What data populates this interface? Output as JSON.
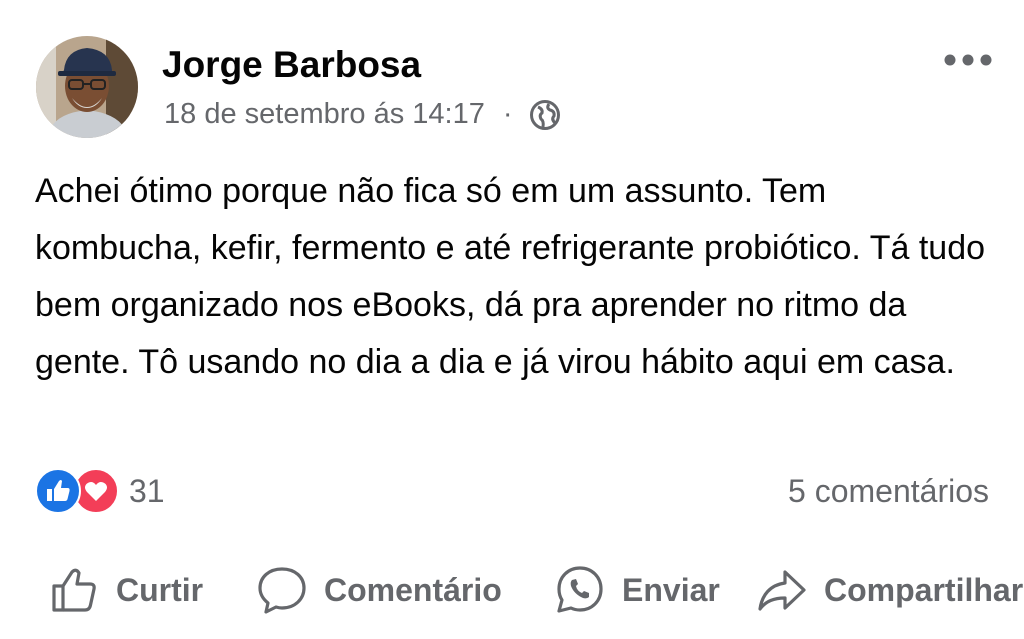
{
  "post": {
    "author": "Jorge Barbosa",
    "timestamp": "18 de setembro ás 14:17",
    "separator": "·",
    "privacy_icon": "globe-icon",
    "text": "Achei ótimo porque não fica só em um assunto. Tem kombucha, kefir, fermento e até refrigerante probiótico. Tá tudo bem organizado nos eBooks, dá pra aprender no ritmo da gente. Tô usando no dia a dia e já virou hábito aqui em casa."
  },
  "reactions": {
    "types": [
      "like-icon",
      "love-icon"
    ],
    "count": "31",
    "comments": "5 comentários"
  },
  "actions": {
    "like": "Curtir",
    "comment": "Comentário",
    "send": "Enviar",
    "share": "Compartilhar"
  },
  "colors": {
    "like_blue": "#1b74e4",
    "love_red": "#f33e58",
    "secondary_text": "#65676b",
    "primary_text": "#050505"
  }
}
